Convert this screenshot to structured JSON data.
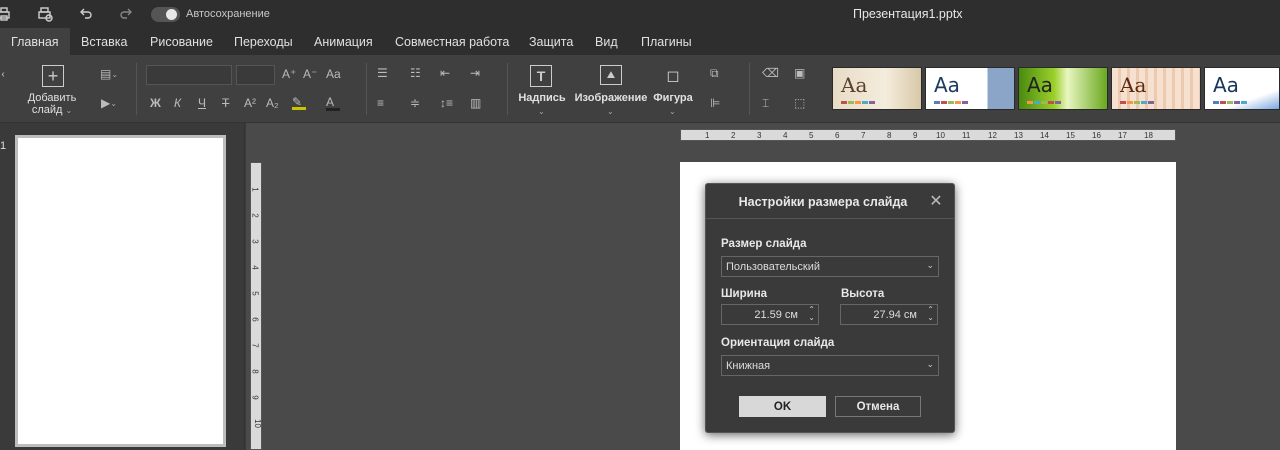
{
  "titlebar": {
    "autosave_label": "Автосохранение",
    "autosave_on": true,
    "doc_title": "Презентация1.pptx",
    "icons": [
      "print-icon",
      "quick-print-icon",
      "undo-icon",
      "redo-icon"
    ]
  },
  "tabs": [
    {
      "label": "Главная",
      "active": true
    },
    {
      "label": "Вставка"
    },
    {
      "label": "Рисование"
    },
    {
      "label": "Переходы"
    },
    {
      "label": "Анимация"
    },
    {
      "label": "Совместная работа"
    },
    {
      "label": "Защита"
    },
    {
      "label": "Вид"
    },
    {
      "label": "Плагины"
    }
  ],
  "ribbon": {
    "add_slide_line1": "Добавить",
    "add_slide_line2": "слайд",
    "text_box_label": "Надпись",
    "image_label": "Изображение",
    "shape_label": "Фигура",
    "font_buttons": {
      "bold": "Ж",
      "italic": "К",
      "underline": "Ч",
      "strike": "Т",
      "superscript": "A²",
      "subscript": "A₂",
      "grow": "A⁺",
      "shrink": "A⁻",
      "case": "Aa"
    },
    "theme_text": "Aa",
    "theme_colors": {
      "accent": [
        "#5b7fb0",
        "#c0504d",
        "#9bbb59",
        "#f79646",
        "#8064a2",
        "#4bacc6"
      ]
    }
  },
  "thumbnails": [
    {
      "number": "1"
    }
  ],
  "ruler": {
    "horizontal": [
      "1",
      "2",
      "3",
      "4",
      "5",
      "6",
      "7",
      "8",
      "9",
      "10",
      "11",
      "12",
      "13",
      "14",
      "15",
      "16",
      "17",
      "18"
    ],
    "vertical": [
      "1",
      "2",
      "3",
      "4",
      "5",
      "6",
      "7",
      "8",
      "9",
      "10"
    ]
  },
  "dialog": {
    "title": "Настройки размера слайда",
    "slide_size_label": "Размер слайда",
    "slide_size_value": "Пользовательский",
    "width_label": "Ширина",
    "width_value": "21.59 см",
    "height_label": "Высота",
    "height_value": "27.94 см",
    "orientation_label": "Ориентация слайда",
    "orientation_value": "Книжная",
    "ok_label": "OK",
    "cancel_label": "Отмена"
  }
}
